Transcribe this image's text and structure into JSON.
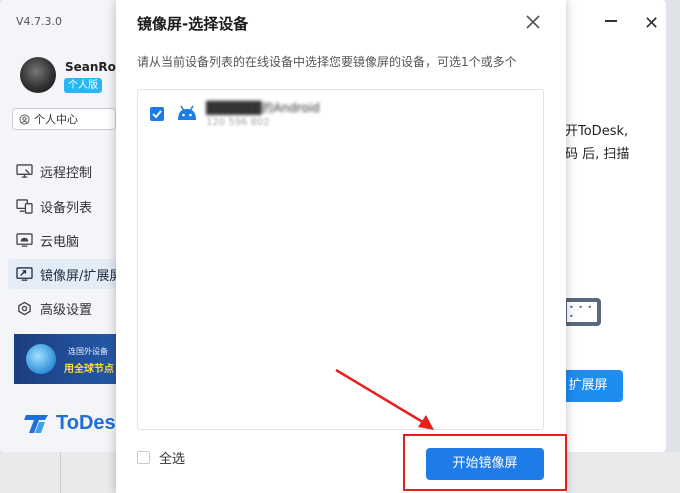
{
  "app": {
    "version": "V4.7.3.0",
    "username": "SeanRow",
    "badge": "个人版",
    "personal_center": "个人中心",
    "nav": [
      {
        "label": "远程控制",
        "icon": "remote-control-icon"
      },
      {
        "label": "设备列表",
        "icon": "device-list-icon"
      },
      {
        "label": "云电脑",
        "icon": "cloud-pc-icon"
      },
      {
        "label": "镜像屏/扩展屏",
        "icon": "mirror-screen-icon",
        "active": true
      },
      {
        "label": "高级设置",
        "icon": "settings-icon"
      }
    ],
    "promo": {
      "line1": "连国外设备",
      "line2": "用全球节点"
    },
    "logo_text": "ToDesk",
    "bg_text1": "开ToDesk,",
    "bg_text2": "码 后, 扫描",
    "bg_button": "扩展屏",
    "accent_color": "#1e7ce8"
  },
  "dialog": {
    "title": "镜像屏-选择设备",
    "description": "请从当前设备列表的在线设备中选择您要镜像屏的设备，可选1个或多个",
    "device": {
      "name": "██████的Android",
      "id": "120 596 802",
      "checked": true
    },
    "select_all_label": "全选",
    "start_button": "开始镜像屏"
  }
}
